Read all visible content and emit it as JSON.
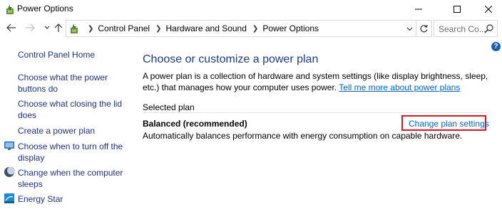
{
  "window": {
    "title": "Power Options",
    "minimize_icon": "minimize-icon",
    "maximize_icon": "maximize-icon",
    "close_icon": "close-icon"
  },
  "nav": {
    "back_icon": "arrow-left-icon",
    "forward_icon": "arrow-right-icon",
    "recent_icon": "chevron-down-icon",
    "up_icon": "arrow-up-icon"
  },
  "address": {
    "crumbs": [
      "Control Panel",
      "Hardware and Sound",
      "Power Options"
    ],
    "refresh_icon": "refresh-icon"
  },
  "search": {
    "placeholder": "Search Co..."
  },
  "help": {
    "label": "?"
  },
  "left_pane": {
    "home": "Control Panel Home",
    "items": [
      "Choose what the power buttons do",
      "Choose what closing the lid does",
      "Create a power plan",
      "Choose when to turn off the display",
      "Change when the computer sleeps",
      "Energy Star"
    ]
  },
  "main": {
    "heading": "Choose or customize a power plan",
    "description": "A power plan is a collection of hardware and system settings (like display brightness, sleep, etc.) that manages how your computer uses power.",
    "learn_more": "Tell me more about power plans",
    "selected_plan_label": "Selected plan",
    "plan_name": "Balanced (recommended)",
    "change_link": "Change plan settings",
    "plan_description": "Automatically balances performance with energy consumption on capable hardware."
  },
  "colors": {
    "link": "#0066cc",
    "heading": "#1e3c8c",
    "nav_link": "#1e3287",
    "highlight_border": "#e0141e"
  }
}
